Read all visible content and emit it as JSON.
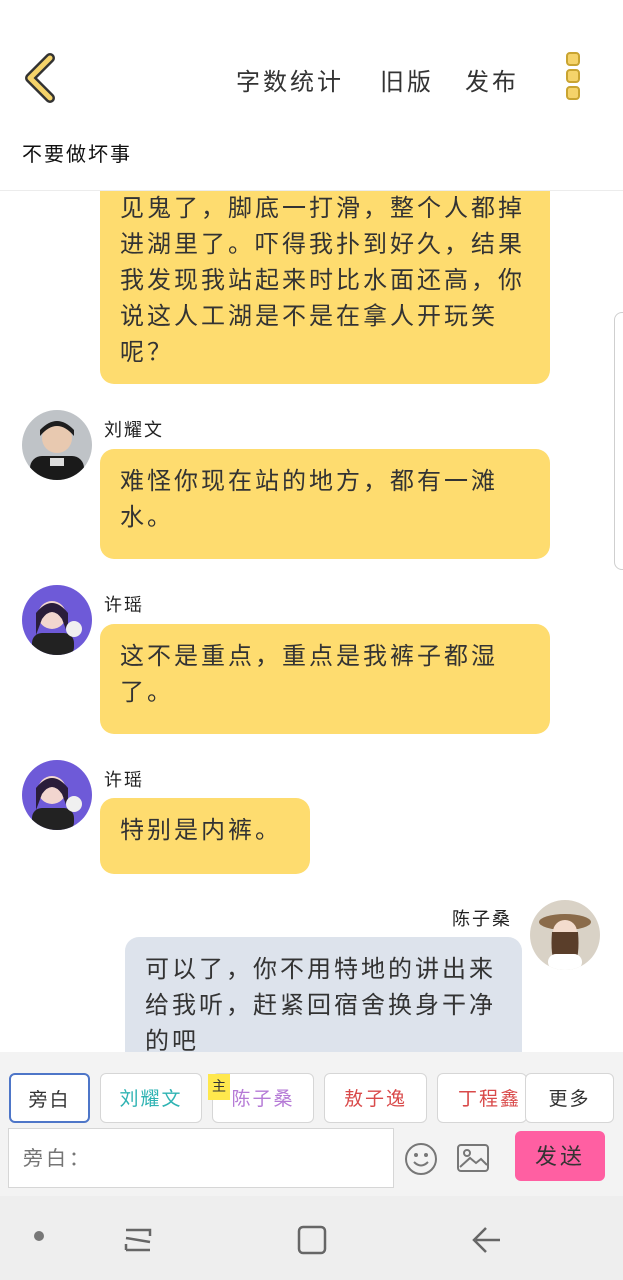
{
  "header": {
    "actions": [
      "字数统计",
      "旧版",
      "发布"
    ],
    "title": "不要做坏事"
  },
  "messages": [
    {
      "speaker": "",
      "side": "left",
      "text": "见鬼了，脚底一打滑，整个人都掉进湖里了。吓得我扑到好久，结果我发现我站起来时比水面还高，你说这人工湖是不是在拿人开玩笑呢？"
    },
    {
      "speaker": "刘耀文",
      "side": "left",
      "text": "难怪你现在站的地方，都有一滩水。"
    },
    {
      "speaker": "许瑶",
      "side": "left",
      "text": "这不是重点，重点是我裤子都湿了。"
    },
    {
      "speaker": "许瑶",
      "side": "left",
      "text": "特别是内裤。"
    },
    {
      "speaker": "陈子桑",
      "side": "right",
      "text": "可以了，你不用特地的讲出来给我听，赶紧回宿舍换身干净的吧"
    }
  ],
  "characters": [
    {
      "name": "旁白",
      "color": "#333333"
    },
    {
      "name": "刘耀文",
      "color": "#2fb3b3"
    },
    {
      "name": "陈子桑",
      "color": "#b57ad6"
    },
    {
      "name": "敖子逸",
      "color": "#d94a4a"
    },
    {
      "name": "丁程鑫",
      "color": "#d94a4a"
    },
    {
      "name": "更多",
      "color": "#333333"
    }
  ],
  "host_tag": "主",
  "composer": {
    "placeholder": "旁白：",
    "send_label": "发送"
  },
  "colors": {
    "bubble": "#fedc6f",
    "self_bubble": "#dde3ec",
    "send": "#ff5fa2",
    "accent_yellow": "#f5d36a"
  }
}
